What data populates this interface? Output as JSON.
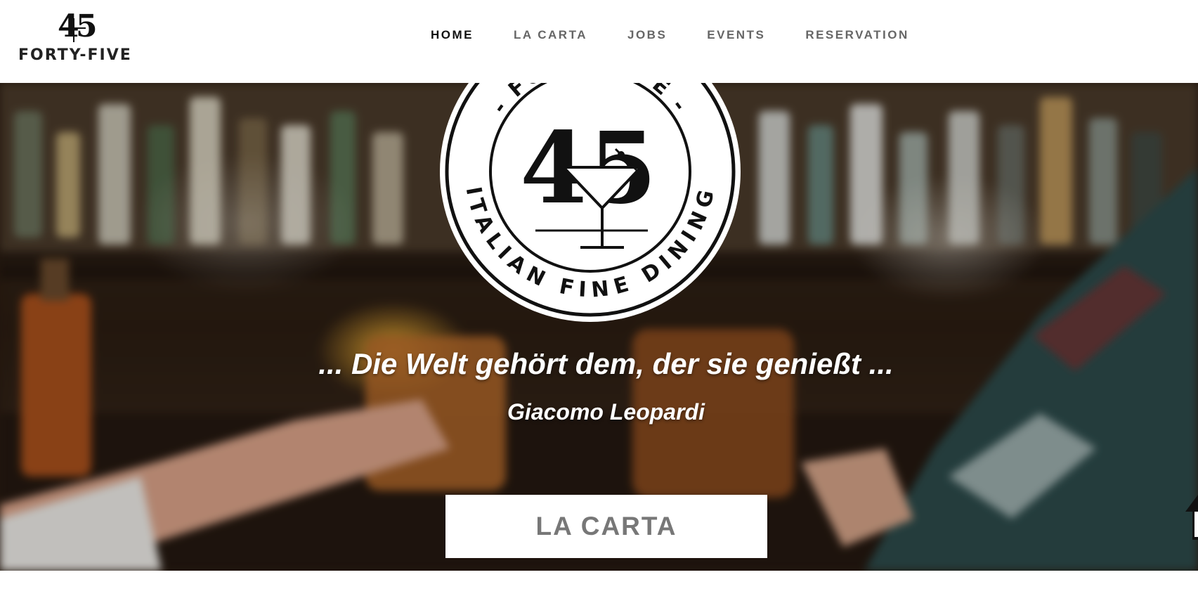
{
  "header": {
    "logo_mark": "45",
    "logo_name": "FORTY-FIVE",
    "nav": [
      {
        "label": "HOME",
        "active": true
      },
      {
        "label": "LA CARTA",
        "active": false
      },
      {
        "label": "JOBS",
        "active": false
      },
      {
        "label": "EVENTS",
        "active": false
      },
      {
        "label": "RESERVATION",
        "active": false
      }
    ]
  },
  "hero": {
    "emblem": {
      "top_text": "- FORTY-FIVE -",
      "number": "45",
      "bottom_text": "ITALIAN FINE DINING"
    },
    "quote": "... Die Welt gehört dem, der sie genießt ...",
    "author": "Giacomo Leopardi",
    "cta_label": "LA CARTA",
    "background": "blurred-bar-toast-photo"
  },
  "icons": {
    "scroll_top": "arrow-up-icon"
  },
  "colors": {
    "nav_active": "#111111",
    "nav_inactive": "#666666",
    "cta_text": "#777777"
  }
}
